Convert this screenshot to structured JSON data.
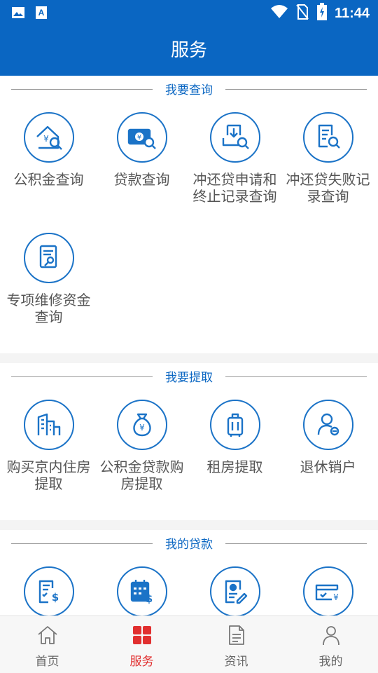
{
  "status_bar": {
    "time": "11:44",
    "left_icons": [
      "image-icon",
      "text-a-icon"
    ],
    "right_icons": [
      "wifi-icon",
      "no-sim-icon",
      "battery-charging-icon"
    ]
  },
  "header": {
    "title": "服务"
  },
  "sections": [
    {
      "title": "我要查询",
      "items": [
        {
          "label": "公积金查询",
          "icon": "house-search-icon"
        },
        {
          "label": "贷款查询",
          "icon": "money-search-icon"
        },
        {
          "label": "冲还贷申请和终止记录查询",
          "icon": "tray-search-icon"
        },
        {
          "label": "冲还贷失败记录查询",
          "icon": "document-search-icon"
        },
        {
          "label": "专项维修资金查询",
          "icon": "document-wrench-icon"
        }
      ]
    },
    {
      "title": "我要提取",
      "items": [
        {
          "label": "购买京内住房提取",
          "icon": "buildings-icon"
        },
        {
          "label": "公积金贷款购房提取",
          "icon": "money-bag-icon"
        },
        {
          "label": "租房提取",
          "icon": "luggage-icon"
        },
        {
          "label": "退休销户",
          "icon": "person-minus-icon"
        }
      ]
    },
    {
      "title": "我的贷款",
      "items": [
        {
          "label": "",
          "icon": "list-dollar-icon"
        },
        {
          "label": "",
          "icon": "calendar-dollar-icon"
        },
        {
          "label": "",
          "icon": "form-edit-icon"
        },
        {
          "label": "",
          "icon": "card-yen-icon"
        }
      ]
    }
  ],
  "tabs": [
    {
      "label": "首页",
      "icon": "home-icon",
      "active": false
    },
    {
      "label": "服务",
      "icon": "grid-icon",
      "active": true
    },
    {
      "label": "资讯",
      "icon": "news-icon",
      "active": false
    },
    {
      "label": "我的",
      "icon": "user-icon",
      "active": false
    }
  ],
  "colors": {
    "primary": "#0a66c2",
    "active_tab": "#e12f2f",
    "icon_stroke": "#1b73c7"
  }
}
